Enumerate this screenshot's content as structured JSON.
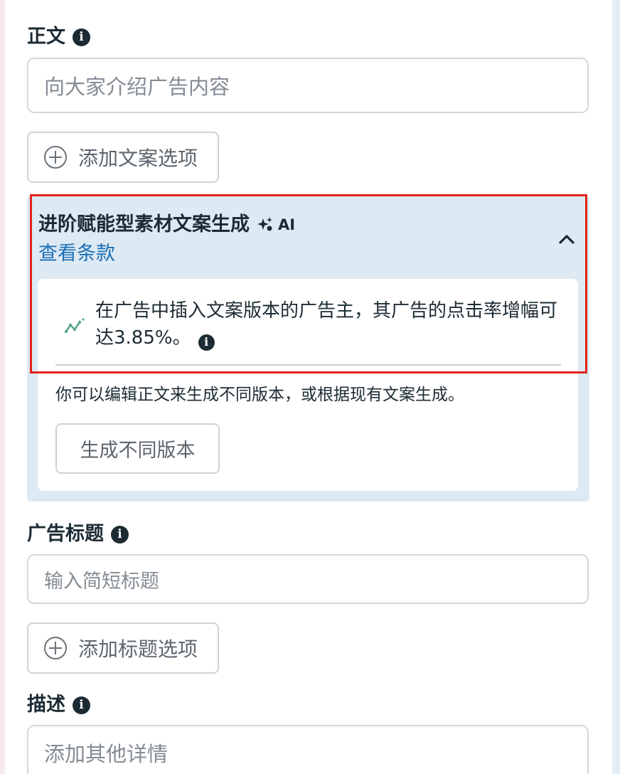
{
  "body_section": {
    "label": "正文",
    "placeholder": "向大家介绍广告内容",
    "add_option_label": "添加文案选项"
  },
  "ai_section": {
    "title": "进阶赋能型素材文案生成",
    "badge": "AI",
    "terms_link": "查看条款",
    "stat_text": "在广告中插入文案版本的广告主，其广告的点击率增幅可达3.85%。",
    "hint_text": "你可以编辑正文来生成不同版本，或根据现有文案生成。",
    "generate_button": "生成不同版本"
  },
  "headline_section": {
    "label": "广告标题",
    "placeholder": "输入简短标题",
    "add_option_label": "添加标题选项"
  },
  "description_section": {
    "label": "描述",
    "placeholder": "添加其他详情"
  },
  "icons": {
    "info": "info-icon",
    "add": "plus-circle-icon",
    "ai": "sparkle-icon",
    "collapse": "chevron-up-icon",
    "trend": "trend-line-icon"
  },
  "colors": {
    "link": "#1a6fb5",
    "panel_bg": "#dde9f3",
    "highlight_border": "#e0241c",
    "trend_icon": "#5aa58c"
  }
}
